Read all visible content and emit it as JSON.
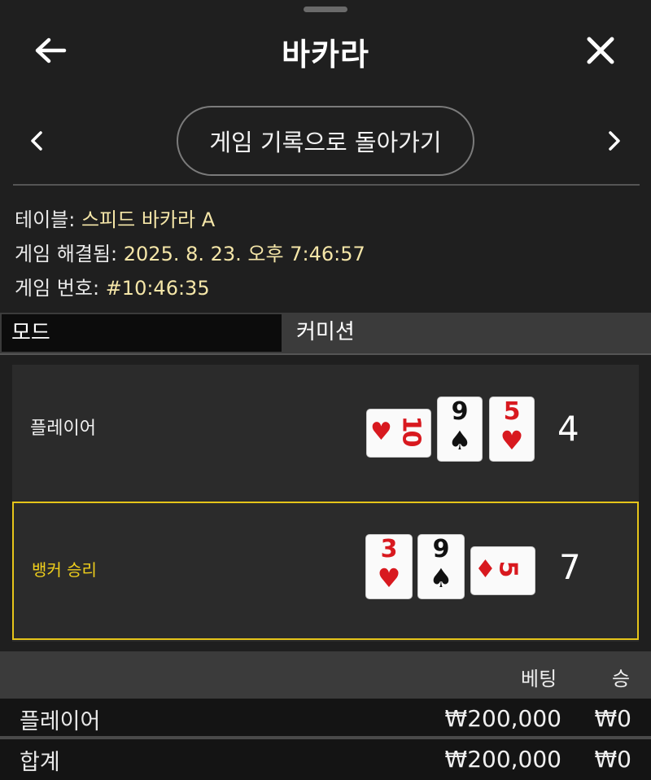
{
  "header": {
    "title": "바카라",
    "back_icon": "arrow-left-icon",
    "close_icon": "close-icon"
  },
  "nav": {
    "back_to_history_label": "게임 기록으로 돌아가기",
    "prev_icon": "chevron-left-icon",
    "next_icon": "chevron-right-icon"
  },
  "info": {
    "table_label": "테이블:",
    "table_value": "스피드 바카라 A",
    "resolved_label": "게임 해결됨:",
    "resolved_value": "2025. 8. 23. 오후 7:46:57",
    "game_no_label": "게임 번호:",
    "game_no_value": "#10:46:35"
  },
  "mode": {
    "label": "모드",
    "value": "커미션"
  },
  "result": {
    "player": {
      "label": "플레이어",
      "score": "4",
      "cards": [
        {
          "rank": "10",
          "suit": "♥",
          "color": "#d8191f",
          "rotated": true
        },
        {
          "rank": "9",
          "suit": "♠",
          "color": "#111111",
          "rotated": false
        },
        {
          "rank": "5",
          "suit": "♥",
          "color": "#d8191f",
          "rotated": false
        }
      ]
    },
    "banker": {
      "label": "뱅커 승리",
      "score": "7",
      "highlight_color": "#e6c51a",
      "cards": [
        {
          "rank": "3",
          "suit": "♥",
          "color": "#d8191f",
          "rotated": false
        },
        {
          "rank": "9",
          "suit": "♠",
          "color": "#111111",
          "rotated": false
        },
        {
          "rank": "5",
          "suit": "♦",
          "color": "#d8191f",
          "rotated": true
        }
      ]
    }
  },
  "bets": {
    "col_bet": "베팅",
    "col_win": "승",
    "rows": [
      {
        "name": "플레이어",
        "bet": "₩200,000",
        "win": "₩0"
      },
      {
        "name": "합계",
        "bet": "₩200,000",
        "win": "₩0"
      }
    ]
  }
}
